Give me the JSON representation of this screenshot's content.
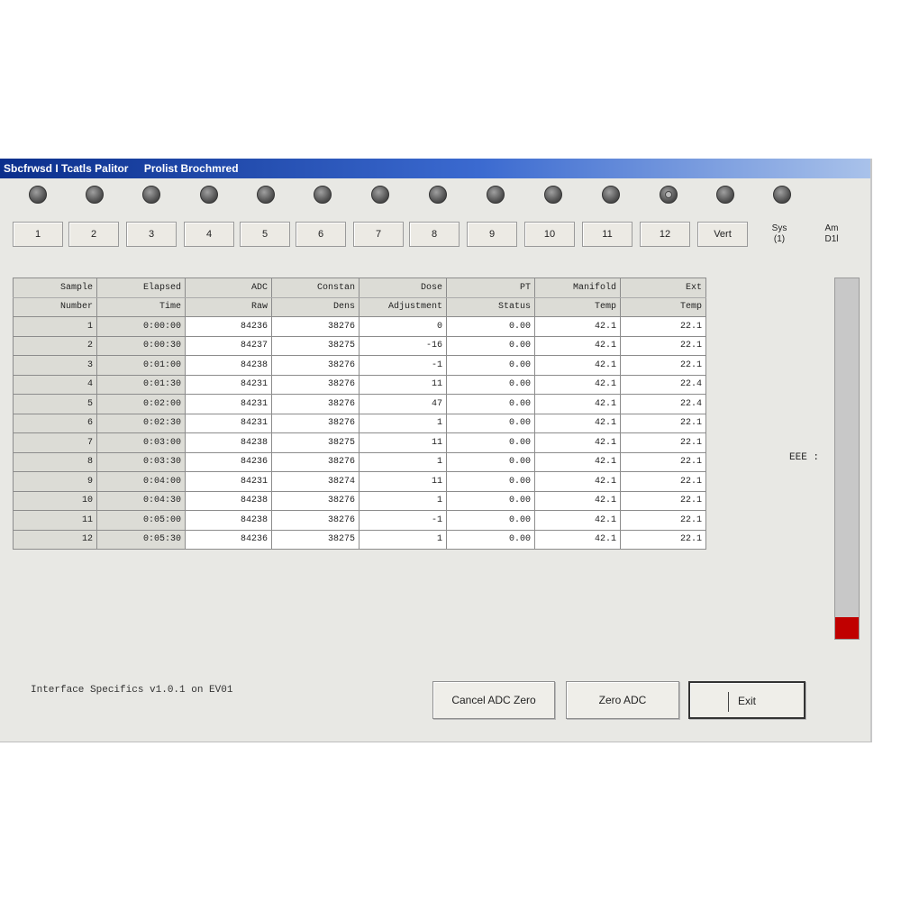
{
  "window": {
    "title_parts": [
      "Sbcfrwsd I Tcatls Palitor",
      "Prolist Brochmred"
    ]
  },
  "leds": [
    {
      "name": "led-1",
      "special": false
    },
    {
      "name": "led-2",
      "special": false
    },
    {
      "name": "led-3",
      "special": false
    },
    {
      "name": "led-4",
      "special": false
    },
    {
      "name": "led-5",
      "special": false
    },
    {
      "name": "led-6",
      "special": false
    },
    {
      "name": "led-7",
      "special": false
    },
    {
      "name": "led-8",
      "special": false
    },
    {
      "name": "led-9",
      "special": false
    },
    {
      "name": "led-10",
      "special": false
    },
    {
      "name": "led-11",
      "special": false
    },
    {
      "name": "led-12",
      "special": true
    },
    {
      "name": "led-13",
      "special": false
    },
    {
      "name": "led-14",
      "special": false
    }
  ],
  "channel_buttons": [
    "1",
    "2",
    "3",
    "4",
    "5",
    "6",
    "7",
    "8",
    "9",
    "10",
    "11",
    "12",
    "Vert"
  ],
  "top_labels": [
    {
      "line1": "Sys",
      "line2": "(1)"
    },
    {
      "line1": "Am",
      "line2": "D1l"
    }
  ],
  "table": {
    "headers_row1": [
      "Sample",
      "Elapsed",
      "ADC",
      "Constan",
      "Dose",
      "PT",
      "Manifold",
      "Ext"
    ],
    "headers_row2": [
      "Number",
      "Time",
      "Raw",
      "Dens",
      "Adjustment",
      "Status",
      "Temp",
      "Temp"
    ],
    "rows": [
      [
        "1",
        "0:00:00",
        "84236",
        "38276",
        "0",
        "0.00",
        "42.1",
        "22.1"
      ],
      [
        "2",
        "0:00:30",
        "84237",
        "38275",
        "-16",
        "0.00",
        "42.1",
        "22.1"
      ],
      [
        "3",
        "0:01:00",
        "84238",
        "38276",
        "-1",
        "0.00",
        "42.1",
        "22.1"
      ],
      [
        "4",
        "0:01:30",
        "84231",
        "38276",
        "11",
        "0.00",
        "42.1",
        "22.4"
      ],
      [
        "5",
        "0:02:00",
        "84231",
        "38276",
        "47",
        "0.00",
        "42.1",
        "22.4"
      ],
      [
        "6",
        "0:02:30",
        "84231",
        "38276",
        "1",
        "0.00",
        "42.1",
        "22.1"
      ],
      [
        "7",
        "0:03:00",
        "84238",
        "38275",
        "11",
        "0.00",
        "42.1",
        "22.1"
      ],
      [
        "8",
        "0:03:30",
        "84236",
        "38276",
        "1",
        "0.00",
        "42.1",
        "22.1"
      ],
      [
        "9",
        "0:04:00",
        "84231",
        "38274",
        "11",
        "0.00",
        "42.1",
        "22.1"
      ],
      [
        "10",
        "0:04:30",
        "84238",
        "38276",
        "1",
        "0.00",
        "42.1",
        "22.1"
      ],
      [
        "11",
        "0:05:00",
        "84238",
        "38276",
        "-1",
        "0.00",
        "42.1",
        "22.1"
      ],
      [
        "12",
        "0:05:30",
        "84236",
        "38275",
        "1",
        "0.00",
        "42.1",
        "22.1"
      ]
    ]
  },
  "meter": {
    "label": "EEE :",
    "level": 0.06,
    "fill_color": "#c00000"
  },
  "status_text": "Interface Specifics v1.0.1 on EV01",
  "buttons": {
    "cancel_label": "Cancel ADC Zero",
    "zero_label": "Zero ADC",
    "exit_label": "Exit"
  }
}
